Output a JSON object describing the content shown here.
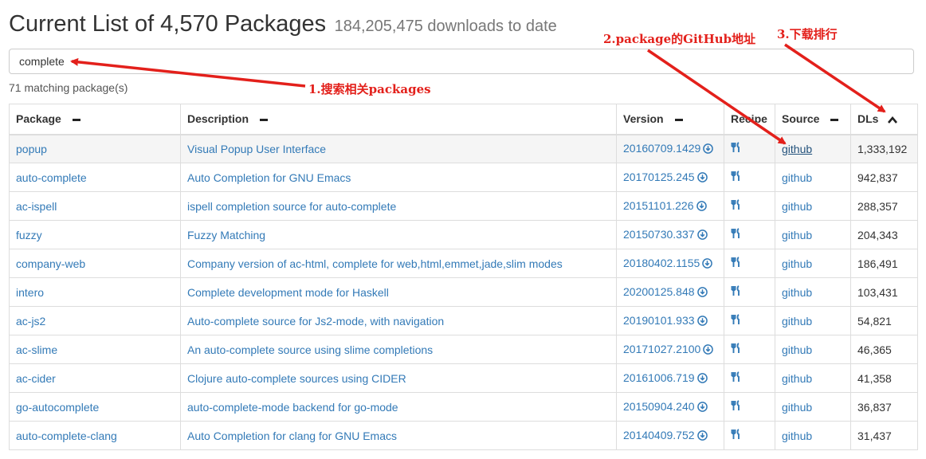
{
  "header": {
    "title": "Current List of 4,570 Packages",
    "subtitle": "184,205,475 downloads to date"
  },
  "search": {
    "value": "complete"
  },
  "match_count": "71 matching package(s)",
  "table": {
    "columns": [
      "Package",
      "Description",
      "Version",
      "Recipe",
      "Source",
      "DLs"
    ],
    "sort_column": "DLs",
    "sort_direction": "descending",
    "rows": [
      {
        "package": "popup",
        "description": "Visual Popup User Interface",
        "version": "20160709.1429",
        "source": "github",
        "dls": "1,333,192"
      },
      {
        "package": "auto-complete",
        "description": "Auto Completion for GNU Emacs",
        "version": "20170125.245",
        "source": "github",
        "dls": "942,837"
      },
      {
        "package": "ac-ispell",
        "description": "ispell completion source for auto-complete",
        "version": "20151101.226",
        "source": "github",
        "dls": "288,357"
      },
      {
        "package": "fuzzy",
        "description": "Fuzzy Matching",
        "version": "20150730.337",
        "source": "github",
        "dls": "204,343"
      },
      {
        "package": "company-web",
        "description": "Company version of ac-html, complete for web,html,emmet,jade,slim modes",
        "version": "20180402.1155",
        "source": "github",
        "dls": "186,491"
      },
      {
        "package": "intero",
        "description": "Complete development mode for Haskell",
        "version": "20200125.848",
        "source": "github",
        "dls": "103,431"
      },
      {
        "package": "ac-js2",
        "description": "Auto-complete source for Js2-mode, with navigation",
        "version": "20190101.933",
        "source": "github",
        "dls": "54,821"
      },
      {
        "package": "ac-slime",
        "description": "An auto-complete source using slime completions",
        "version": "20171027.2100",
        "source": "github",
        "dls": "46,365"
      },
      {
        "package": "ac-cider",
        "description": "Clojure auto-complete sources using CIDER",
        "version": "20161006.719",
        "source": "github",
        "dls": "41,358"
      },
      {
        "package": "go-autocomplete",
        "description": "auto-complete-mode backend for go-mode",
        "version": "20150904.240",
        "source": "github",
        "dls": "36,837"
      },
      {
        "package": "auto-complete-clang",
        "description": "Auto Completion for clang for GNU Emacs",
        "version": "20140409.752",
        "source": "github",
        "dls": "31,437"
      }
    ]
  },
  "annotations": {
    "a1": "1.搜索相关packages",
    "a2": "2.package的GitHub地址",
    "a3": "3.下载排行",
    "color": "#e3201b"
  },
  "colors": {
    "link": "#337ab7",
    "border": "#dddddd"
  },
  "icons": {
    "download": "download-circle-icon",
    "recipe": "fork-knife-icon",
    "sort": "chevron-up-icon",
    "unsorted": "minus-icon"
  }
}
